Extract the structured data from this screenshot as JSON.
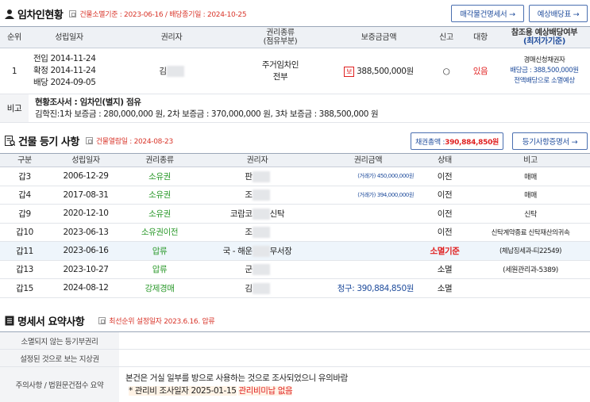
{
  "tenant": {
    "title": "임차인현황",
    "subtitle": "건물소멸기준 : 2023-06-16 / 배당종기일 : 2024-10-25",
    "buttons": {
      "doc": "매각물건명세서 →",
      "dividend": "예상배당표 →"
    },
    "headers": {
      "rank": "순위",
      "date": "성립일자",
      "holder": "권리자",
      "type_l1": "권리종류",
      "type_l2": "(점유부분)",
      "deposit": "보증금금액",
      "report": "신고",
      "oppose": "대항",
      "ref_l1": "참조용 예상배당여부",
      "ref_l2": "(최저가기준)"
    },
    "row": {
      "rank": "1",
      "date1": "전입 2014-11-24",
      "date2": "확정 2014-11-24",
      "date3": "배당 2024-09-05",
      "holder": "김",
      "type1": "주거임차인",
      "type2": "전부",
      "deposit_badge": "보",
      "deposit": "388,500,000원",
      "report": "○",
      "oppose": "있음",
      "ref1": "경매신청채권자",
      "ref2": "배당금 : 388,500,000원",
      "ref3": "전액배당으로 소멸예상"
    },
    "note_label": "비고",
    "note_title": "현황조사서 : 임차인(별지) 점유",
    "note_body": "김학진:1차 보증금 : 280,000,000 원, 2차 보증금 : 370,000,000 원, 3차 보증금 : 388,500,000 원"
  },
  "registry": {
    "title": "건물 등기 사항",
    "subtitle": "건물열람일 : 2024-08-23",
    "claim_label": "채권총액 : ",
    "claim_value": "390,884,850원",
    "button": "등기사항증명서 →",
    "headers": [
      "구분",
      "성립일자",
      "권리종류",
      "권리자",
      "권리금액",
      "상태",
      "비고"
    ],
    "rows": [
      {
        "kind": "갑3",
        "date": "2006-12-29",
        "type": "소유권",
        "type_color": "green",
        "holder_pre": "판",
        "holder_post": "",
        "amount": "(거래가) 450,000,000원",
        "amount_small": true,
        "status": "이전",
        "status_color": "",
        "note": "매매"
      },
      {
        "kind": "갑4",
        "date": "2017-08-31",
        "type": "소유권",
        "type_color": "green",
        "holder_pre": "조",
        "holder_post": "",
        "amount": "(거래가) 394,000,000원",
        "amount_small": true,
        "status": "이전",
        "status_color": "",
        "note": "매매"
      },
      {
        "kind": "갑9",
        "date": "2020-12-10",
        "type": "소유권",
        "type_color": "green",
        "holder_pre": "코람코",
        "holder_post": "신탁",
        "amount": "",
        "amount_small": false,
        "status": "이전",
        "status_color": "",
        "note": "신탁"
      },
      {
        "kind": "갑10",
        "date": "2023-06-13",
        "type": "소유권이전",
        "type_color": "green",
        "holder_pre": "조",
        "holder_post": "",
        "amount": "",
        "amount_small": false,
        "status": "이전",
        "status_color": "",
        "note": "신탁계약종료 신탁재산의귀속"
      },
      {
        "kind": "갑11",
        "date": "2023-06-16",
        "type": "압류",
        "type_color": "green",
        "holder_pre": "국 - 해운",
        "holder_post": "무서장",
        "amount": "",
        "amount_small": false,
        "status": "소멸기준",
        "status_color": "red",
        "note": "(체납징세과-티22549)",
        "highlight": true
      },
      {
        "kind": "갑13",
        "date": "2023-10-27",
        "type": "압류",
        "type_color": "green",
        "holder_pre": "군",
        "holder_post": "",
        "amount": "",
        "amount_small": false,
        "status": "소멸",
        "status_color": "",
        "note": "(세원관리과-5389)"
      },
      {
        "kind": "갑15",
        "date": "2024-08-12",
        "type": "강제경매",
        "type_color": "green",
        "holder_pre": "김",
        "holder_post": "",
        "amount": "청구: 390,884,850원",
        "amount_small": false,
        "status": "소멸",
        "status_color": "",
        "note": ""
      }
    ]
  },
  "summary": {
    "title": "명세서 요약사항",
    "subtitle": "최선순위 설정일자 2023.6.16. 압류",
    "rows": [
      {
        "label": "소멸되지 않는 등기부권리",
        "value": ""
      },
      {
        "label": "설정된 것으로 보는 지상권",
        "value": ""
      },
      {
        "label": "주의사항 / 법원문건접수 요약",
        "value": "본건은 거실 일부를 방으로 사용하는 것으로 조사되었으니 유의바람"
      }
    ],
    "mgmt_prefix": "* 관리비 조사일자 2025-01-15",
    "mgmt_status": "관리비미납 없음"
  },
  "colors": {
    "accent": "#1f4c9c",
    "alert": "#e02020",
    "green": "#2c9a2c"
  }
}
